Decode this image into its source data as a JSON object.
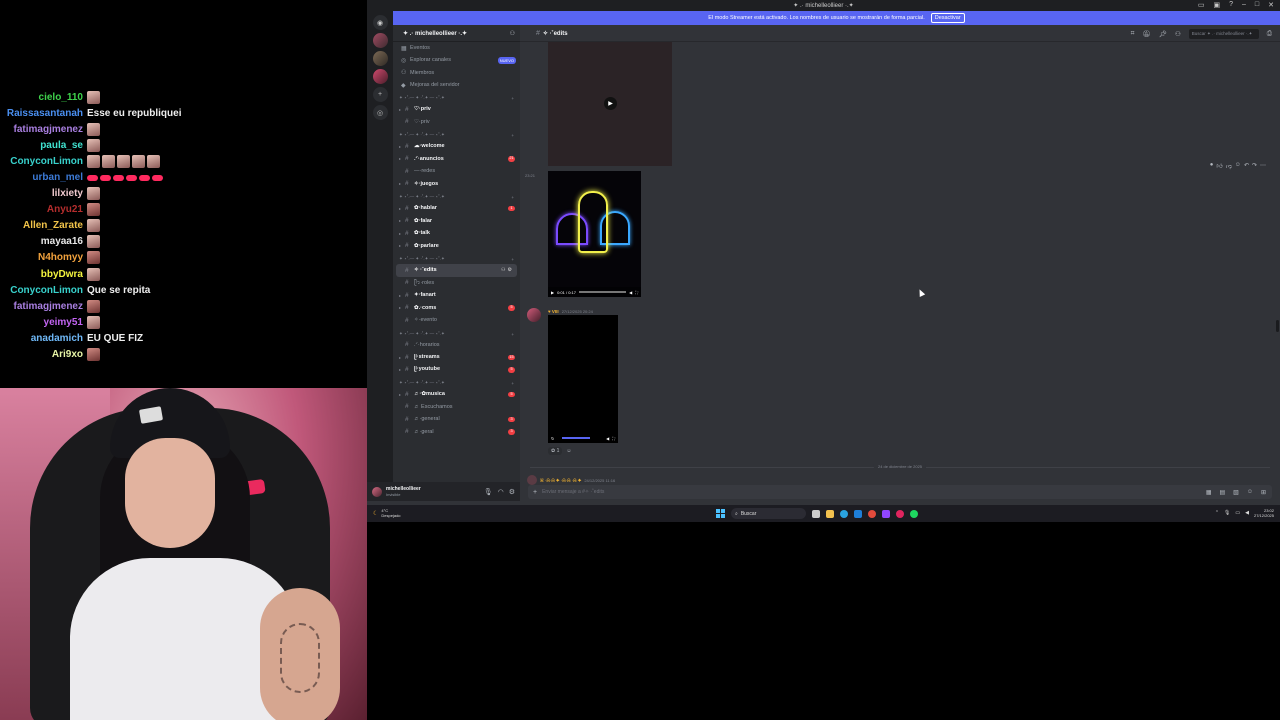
{
  "chat": {
    "messages": [
      {
        "user": "cielo_110",
        "color": "#3fd24c",
        "text": "",
        "emotes": [
          "face"
        ]
      },
      {
        "user": "Raissasantanah",
        "color": "#4a8ff0",
        "text": "Esse eu republiquei",
        "emotes": []
      },
      {
        "user": "fatimagjmenez",
        "color": "#a97fe0",
        "text": "",
        "emotes": [
          "face"
        ]
      },
      {
        "user": "paula_se",
        "color": "#40e2d0",
        "text": "",
        "emotes": [
          "face"
        ]
      },
      {
        "user": "ConyconLimon",
        "color": "#38d1cc",
        "text": "",
        "emotes": [
          "face",
          "face",
          "face",
          "face",
          "face"
        ]
      },
      {
        "user": "urban_mel",
        "color": "#3c7ad6",
        "text": "",
        "emotes": [
          "dot",
          "dot",
          "dot",
          "dot",
          "dot",
          "dot"
        ]
      },
      {
        "user": "lilxiety",
        "color": "#f0c9ce",
        "text": "",
        "emotes": [
          "face"
        ]
      },
      {
        "user": "Anyu21",
        "color": "#b42d2d",
        "text": "",
        "emotes": [
          "alt"
        ]
      },
      {
        "user": "Allen_Zarate",
        "color": "#f2c44a",
        "text": "",
        "emotes": [
          "face"
        ]
      },
      {
        "user": "mayaa16",
        "color": "#e8e8e8",
        "text": "",
        "emotes": [
          "face"
        ]
      },
      {
        "user": "N4homyy",
        "color": "#f2a23d",
        "text": "",
        "emotes": [
          "alt"
        ]
      },
      {
        "user": "bbyDwra",
        "color": "#f5f53f",
        "text": "",
        "emotes": [
          "face"
        ]
      },
      {
        "user": "ConyconLimon",
        "color": "#38d1cc",
        "text": "Que se repita",
        "emotes": []
      },
      {
        "user": "fatimagjmenez",
        "color": "#a97fe0",
        "text": "",
        "emotes": [
          "alt"
        ]
      },
      {
        "user": "yeimy51",
        "color": "#c264f2",
        "text": "",
        "emotes": [
          "face"
        ]
      },
      {
        "user": "anadamich",
        "color": "#6fb8f7",
        "text": "EU QUE FIZ",
        "emotes": []
      },
      {
        "user": "Ari9xo",
        "color": "#e8f5a7",
        "text": "",
        "emotes": [
          "alt"
        ]
      }
    ]
  },
  "window": {
    "title": "✦ .· michelleollieer ·.✦",
    "notice_text": "El modo Streamer está activado. Los nombres de usuario se mostrarán de forma parcial.",
    "notice_button": "Desactivar"
  },
  "server": {
    "name": "✦ .· michelleollieer ·.✦",
    "shortcuts": [
      {
        "icon": "calendar-icon",
        "label": "Eventos"
      },
      {
        "icon": "compass-icon",
        "label": "Explorar canales",
        "badge": "NUEVO"
      },
      {
        "icon": "members-icon",
        "label": "Miembros"
      },
      {
        "icon": "boost-icon",
        "label": "Mejoras del servidor"
      }
    ],
    "categories": [
      {
        "name": "✦ ⋆˚.— ✦ ·˚.✦ — ⋆˚.✦",
        "channels": [
          {
            "name": "♡·priv",
            "bold": true
          },
          {
            "name": "♡·priv"
          }
        ]
      },
      {
        "name": "✦ ⋆˚.— ✦ ·˚.✦ — ⋆˚.✦",
        "channels": [
          {
            "name": "☁︎·welcome",
            "bold": true
          },
          {
            "name": ".ᐟ·anuncios",
            "bold": true,
            "badge": "21"
          },
          {
            "name": "—·redes"
          },
          {
            "name": "✧·juegos",
            "bold": true
          }
        ]
      },
      {
        "name": "✦ ⋆˚.— ✦ ·˚.✦ — ⋆˚.✦",
        "channels": [
          {
            "name": "✿·hablar",
            "bold": true,
            "badge": "1"
          },
          {
            "name": "✿·falar",
            "bold": true
          },
          {
            "name": "✿·talk",
            "bold": true
          },
          {
            "name": "✿·parlare",
            "bold": true
          }
        ]
      },
      {
        "name": "✦ ⋆˚.— ✦ ·˚.✦ — ⋆˚.✦",
        "channels": [
          {
            "name": "✧ ·˚edits",
            "active": true
          },
          {
            "name": "ᥫ᭡·roles"
          },
          {
            "name": "✦·fanart",
            "bold": true
          },
          {
            "name": "✿.·coms",
            "bold": true,
            "badge": "5"
          },
          {
            "name": "✧·evento"
          }
        ]
      },
      {
        "name": "✦ ⋆˚.— ✦ ·˚.✦ — ⋆˚.✦",
        "channels": [
          {
            "name": ".ᐟ·horarios"
          },
          {
            "name": "ᥫ·streams",
            "bold": true,
            "badge": "15"
          },
          {
            "name": "ᥫ·youtube",
            "bold": true,
            "badge": "5"
          }
        ]
      },
      {
        "name": "✦ ⋆˚.— ✦ ·˚.✦ — ⋆˚.✦",
        "channels": [
          {
            "name": "♬·✿musica",
            "bold": true,
            "badge": "5"
          },
          {
            "name": "♬ Escuchamos"
          },
          {
            "name": "♬·general",
            "badge": "3"
          },
          {
            "name": "♬·geral",
            "badge": "3"
          }
        ]
      }
    ],
    "user": {
      "name": "michelleollieer",
      "status": "Invisible"
    }
  },
  "channel": {
    "name": "✧ ·˚edits",
    "search_placeholder": "Buscar ✦ .· michelleollieer ·.✦",
    "time1": "23:21",
    "video_time": "0:01 / 0:17",
    "msg2_name": "♥ VIII",
    "msg2_date": "27/12/2025 20:24",
    "reaction_count": "1",
    "divider_text": "24 de diciembre de 2025",
    "msg3_name": "ꕤ ·ᕱ·ᕱ ✦ ·ᕱ·ᕱ ·ᕱ ✦",
    "msg3_date": "24/12/2025 11:16",
    "composer_placeholder": "Enviar mensaje a #✧ ·˚edits"
  },
  "taskbar": {
    "weather_temp": "4°C",
    "weather_label": "Despejado",
    "search_label": "Buscar",
    "time": "23:02",
    "date": "27/12/2025"
  }
}
